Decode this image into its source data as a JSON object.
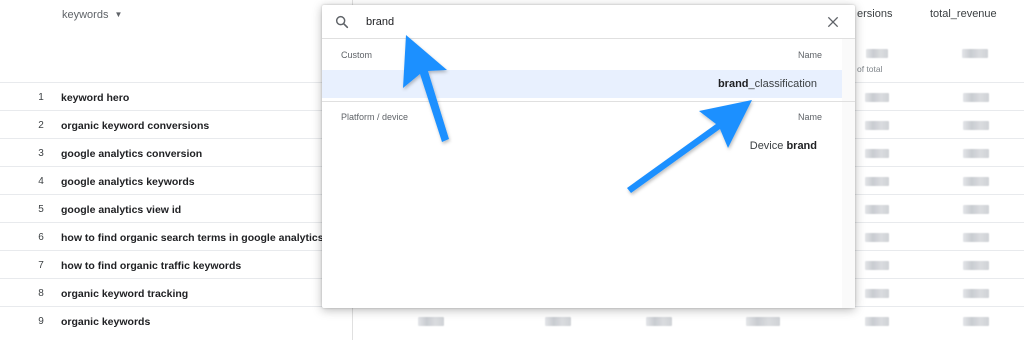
{
  "table": {
    "headers": {
      "keywords": "keywords",
      "conversions": "ersions",
      "total_revenue": "total_revenue",
      "of_total": "of total"
    },
    "rows": [
      {
        "num": "1",
        "keyword": "keyword hero"
      },
      {
        "num": "2",
        "keyword": "organic keyword conversions"
      },
      {
        "num": "3",
        "keyword": "google analytics conversion"
      },
      {
        "num": "4",
        "keyword": "google analytics keywords"
      },
      {
        "num": "5",
        "keyword": "google analytics view id"
      },
      {
        "num": "6",
        "keyword": "how to find organic search terms in google analytics"
      },
      {
        "num": "7",
        "keyword": "how to find organic traffic keywords"
      },
      {
        "num": "8",
        "keyword": "organic keyword tracking"
      },
      {
        "num": "9",
        "keyword": "organic keywords"
      }
    ]
  },
  "modal": {
    "search": {
      "value": "brand"
    },
    "sections": [
      {
        "label": "Custom",
        "name_label": "Name",
        "result": {
          "match": "brand",
          "rest": "_classification",
          "highlighted": true
        }
      },
      {
        "label": "Platform / device",
        "name_label": "Name",
        "result": {
          "prefix": "Device ",
          "match": "brand",
          "highlighted": false
        }
      }
    ]
  },
  "icons": {
    "search": "search-icon",
    "close": "close-icon",
    "sort": "caret-down-icon",
    "annotation": "arrow-annotation"
  },
  "colors": {
    "highlight": "#e8f0fe",
    "arrow": "#1e90ff"
  }
}
